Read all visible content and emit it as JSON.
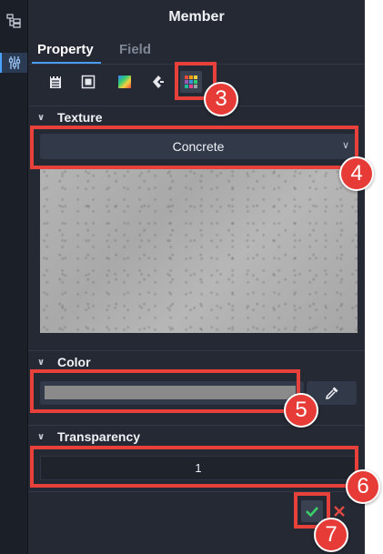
{
  "panel": {
    "title": "Member"
  },
  "tabs": [
    {
      "label": "Property",
      "active": true
    },
    {
      "label": "Field",
      "active": false
    }
  ],
  "toolbar_icons": [
    "notepad-icon",
    "frame-icon",
    "gradient-icon",
    "section-icon",
    "texture-grid-icon"
  ],
  "sections": {
    "texture": {
      "header": "Texture",
      "selected": "Concrete"
    },
    "color": {
      "header": "Color",
      "swatch_color": "#8a8a8a"
    },
    "transparency": {
      "header": "Transparency",
      "value": "1"
    }
  },
  "annotations": {
    "badge_3": "3",
    "badge_4": "4",
    "badge_5": "5",
    "badge_6": "6",
    "badge_7": "7"
  },
  "colors": {
    "accent": "#4a9cf0",
    "highlight": "#e8413b",
    "confirm": "#3ad06a",
    "cancel": "#e04a43"
  }
}
